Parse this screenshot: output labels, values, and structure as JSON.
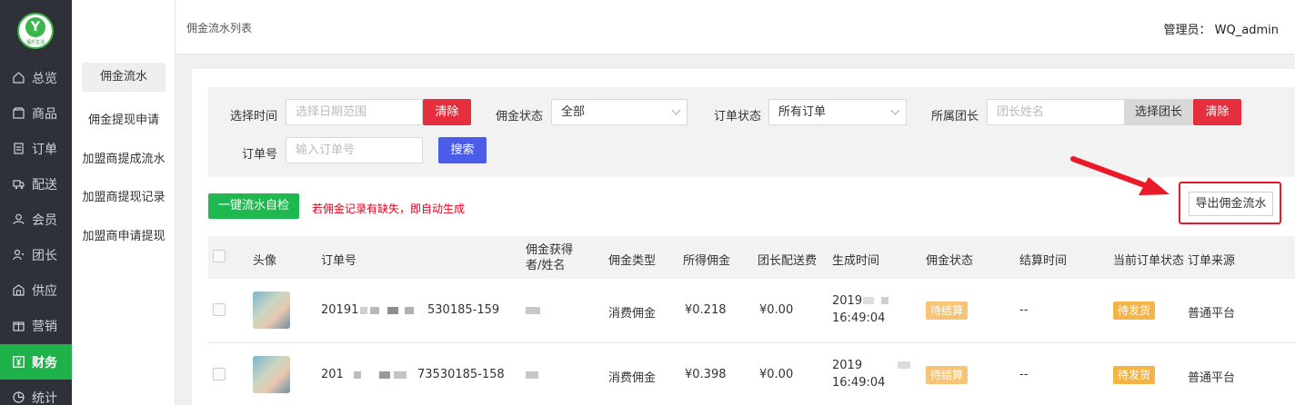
{
  "brand": {
    "logo_text": "福乐生活",
    "accent": "#1fb24a"
  },
  "nav": {
    "items": [
      {
        "label": "总览",
        "icon": "home-icon"
      },
      {
        "label": "商品",
        "icon": "box-icon"
      },
      {
        "label": "订单",
        "icon": "order-icon"
      },
      {
        "label": "配送",
        "icon": "truck-icon"
      },
      {
        "label": "会员",
        "icon": "user-icon"
      },
      {
        "label": "团长",
        "icon": "group-leader-icon"
      },
      {
        "label": "供应",
        "icon": "supply-icon"
      },
      {
        "label": "营销",
        "icon": "gift-icon"
      },
      {
        "label": "财务",
        "icon": "yuan-icon"
      },
      {
        "label": "统计",
        "icon": "chart-icon"
      }
    ],
    "active": "财务"
  },
  "submenu": {
    "items": [
      "佣金流水",
      "佣金提现申请",
      "加盟商提成流水",
      "加盟商提现记录",
      "加盟商申请提现"
    ],
    "active": "佣金流水"
  },
  "topbar": {
    "breadcrumb": "佣金流水列表",
    "admin": "管理员： WQ_admin"
  },
  "filters": {
    "time_label": "选择时间",
    "time_placeholder": "选择日期范围",
    "clear_label": "清除",
    "commission_status_label": "佣金状态",
    "commission_status_value": "全部",
    "order_status_label": "订单状态",
    "order_status_value": "所有订单",
    "leader_label": "所属团长",
    "leader_placeholder": "团长姓名",
    "choose_leader_label": "选择团长",
    "leader_clear_label": "清除",
    "order_no_label": "订单号",
    "order_no_placeholder": "输入订单号",
    "search_label": "搜索"
  },
  "actions": {
    "self_check_label": "一键流水自检",
    "warning_text": "若佣金记录有缺失，即自动生成",
    "export_label": "导出佣金流水"
  },
  "table": {
    "headers": [
      "头像",
      "订单号",
      "佣金获得者/姓名",
      "佣金类型",
      "所得佣金",
      "团长配送费",
      "生成时间",
      "佣金状态",
      "结算时间",
      "当前订单状态",
      "订单来源"
    ],
    "rows": [
      {
        "order_no_a": "20191",
        "order_no_b": "530185-159",
        "type": "消费佣金",
        "commission": "¥0.218",
        "delivery_fee": "¥0.00",
        "time_a": "2019",
        "time_b": "16:49:04",
        "status": "待结算",
        "settle_time": "--",
        "order_status": "待发货",
        "source": "普通平台"
      },
      {
        "order_no_a": "201",
        "order_no_b": "73530185-158",
        "type": "消费佣金",
        "commission": "¥0.398",
        "delivery_fee": "¥0.00",
        "time_a": "2019",
        "time_b": "16:49:04",
        "status": "待结算",
        "settle_time": "--",
        "order_status": "待发货",
        "source": "普通平台"
      }
    ]
  }
}
